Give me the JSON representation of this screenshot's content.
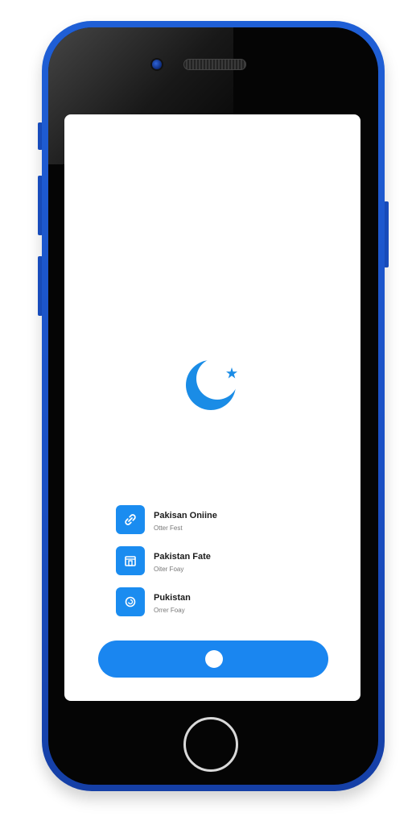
{
  "device": {
    "frame_color": "#1a52c8",
    "screen_color": "#ffffff"
  },
  "app": {
    "logo_icon": "crescent-star-icon",
    "accent_color": "#1a86f0",
    "menu_items": [
      {
        "title": "Pakisan Oniine",
        "subtitle": "Otter Fest",
        "icon": "link-icon"
      },
      {
        "title": "Pakistan Fate",
        "subtitle": "Oiter Foay",
        "icon": "building-icon"
      },
      {
        "title": "Pukistan",
        "subtitle": "Orrer Foay",
        "icon": "refresh-icon"
      }
    ]
  }
}
